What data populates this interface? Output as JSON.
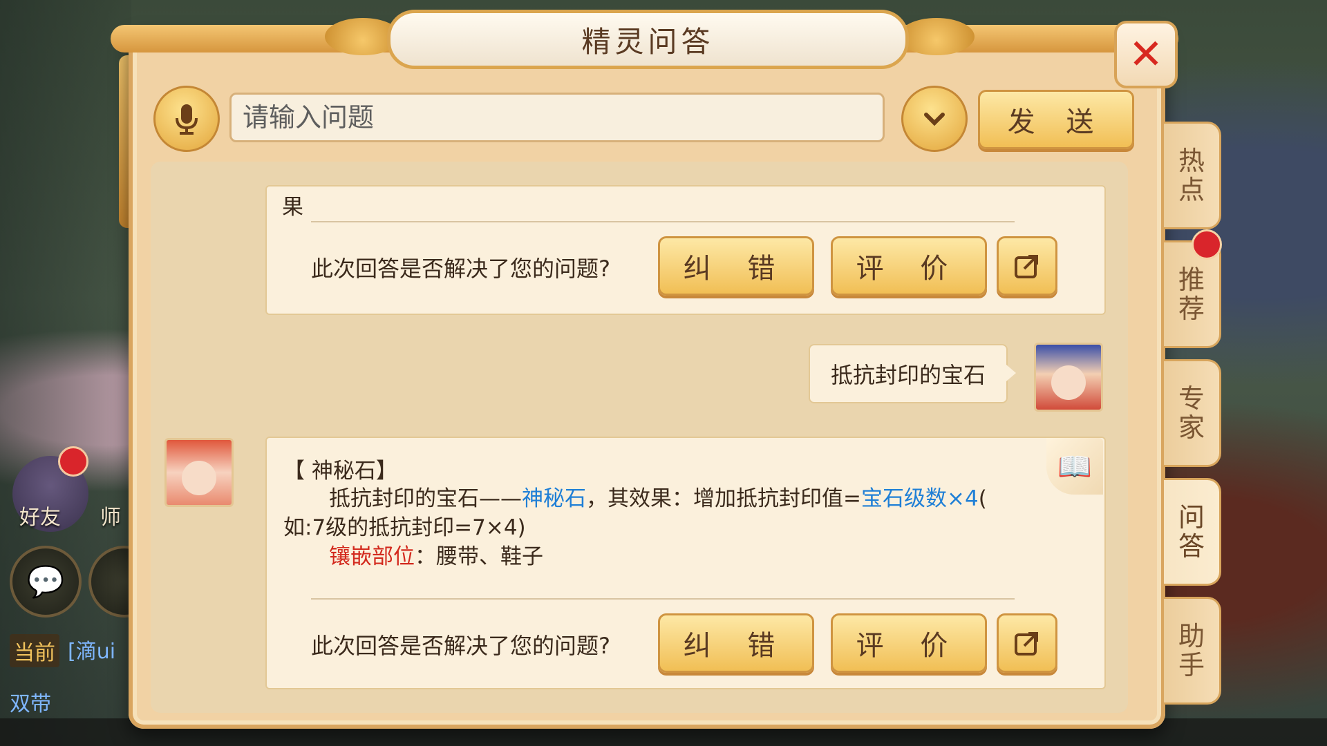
{
  "dialog": {
    "title": "精灵问答",
    "close_glyph": "✕"
  },
  "input": {
    "placeholder": "请输入问题",
    "value": ""
  },
  "toolbar": {
    "send_label": "发 送",
    "mic_icon": "microphone-icon",
    "dropdown_icon": "chevron-down-icon"
  },
  "messages": {
    "card1": {
      "fragment": "果",
      "question": "此次回答是否解决了您的问题?",
      "correct_label": "纠 错",
      "rate_label": "评 价"
    },
    "user": {
      "text": "抵抗封印的宝石"
    },
    "card2": {
      "title": "【 神秘石】",
      "line1_a": "抵抗封印的宝石——",
      "line1_link": "神秘石",
      "line1_b": "，其效果：增加抵抗封印值=",
      "line1_formula": "宝石级数×4",
      "line1_c": "(",
      "line2": "如:7级的抵抗封印=7×4)",
      "line3_label": "镶嵌部位",
      "line3_value": "：腰带、鞋子",
      "question": "此次回答是否解决了您的问题?",
      "correct_label": "纠 错",
      "rate_label": "评 价"
    }
  },
  "tabs": [
    {
      "label_top": "热",
      "label_bottom": "点"
    },
    {
      "label_top": "推",
      "label_bottom": "荐"
    },
    {
      "label_top": "专",
      "label_bottom": "家"
    },
    {
      "label_top": "问",
      "label_bottom": "答"
    },
    {
      "label_top": "助",
      "label_bottom": "手"
    }
  ],
  "game_hud": {
    "friend_label": "好友",
    "mentor_label": "师",
    "channel_current": "当前",
    "channel_text": "[滴ui",
    "channel_second": "双带"
  },
  "colors": {
    "panel": "#f1d2a4",
    "gold_button": "#f1bf55",
    "link_blue": "#1f7fd6",
    "highlight_red": "#d32a1e"
  }
}
